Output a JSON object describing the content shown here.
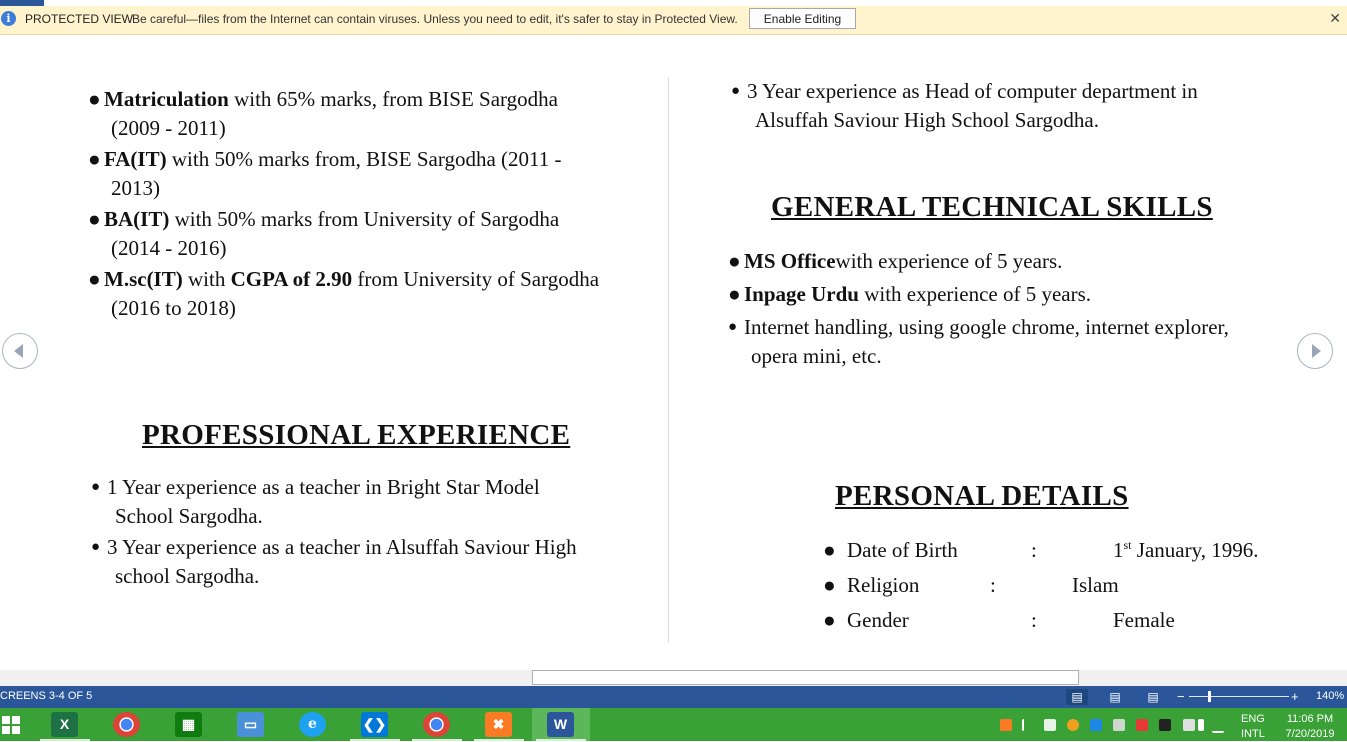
{
  "protected_view": {
    "title": "PROTECTED VIEW",
    "message": "Be careful—files from the Internet can contain viruses. Unless you need to edit, it's safer to stay in Protected View.",
    "enable_button": "Enable Editing",
    "close_glyph": "✕",
    "info_glyph": "i"
  },
  "education": {
    "items": [
      {
        "bold": "Matriculation",
        "rest": " with 65% marks, from BISE Sargodha",
        "line2": "(2009 - 2011)"
      },
      {
        "bold": "FA(IT)",
        "rest": " with 50% marks from, BISE Sargodha  (2011 -",
        "line2": "2013)"
      },
      {
        "bold": "BA(IT)",
        "rest": " with 50% marks from University of  Sargodha",
        "line2": "(2014 - 2016)"
      },
      {
        "bold": "M.sc(IT)",
        "rest_pre": " with ",
        "bold2": "CGPA of 2.90",
        "rest": " from University of Sargodha",
        "line2": "(2016 to 2018)"
      }
    ]
  },
  "professional": {
    "heading": "PROFESSIONAL EXPERIENCE",
    "items": [
      {
        "line1": "1 Year experience as a teacher in Bright Star Model",
        "line2": "School Sargodha."
      },
      {
        "line1": "3 Year experience as a teacher in Alsuffah Saviour High",
        "line2": "school Sargodha."
      }
    ]
  },
  "experience_cont": {
    "line1": "3 Year experience as Head of computer department in",
    "line2": "Alsuffah Saviour High School Sargodha."
  },
  "skills": {
    "heading": "GENERAL TECHNICAL SKILLS",
    "items": [
      {
        "bold": "MS Office",
        "rest": "with experience of 5 years."
      },
      {
        "bold": "Inpage Urdu",
        "rest": " with experience of 5 years."
      },
      {
        "bold": "",
        "rest": "Internet handling, using google chrome, internet explorer,",
        "line2": "opera mini, etc."
      }
    ]
  },
  "personal": {
    "heading": "PERSONAL DETAILS",
    "rows": [
      {
        "label": "Date of Birth",
        "sep": ":",
        "value_pre": "1",
        "value_sup": "st",
        "value": " January, 1996."
      },
      {
        "label": "Religion",
        "sep": ":",
        "value": "Islam"
      },
      {
        "label": "Gender",
        "sep": ":",
        "value": "Female"
      }
    ]
  },
  "bullet": "●",
  "statusbar": {
    "text": "CREENS 3-4 OF 5",
    "zoom": "140%",
    "zoom_minus": "−",
    "zoom_plus": "+"
  },
  "taskbar": {
    "apps": [
      {
        "name": "Excel",
        "letter": "X",
        "color": "#1e7145"
      },
      {
        "name": "Chrome",
        "color": "#db4437"
      },
      {
        "name": "Store",
        "color": "#107c10"
      },
      {
        "name": "This PC",
        "color": "#4a90d9"
      },
      {
        "name": "Internet Explorer",
        "letter": "e",
        "color": "#1ea1f1"
      },
      {
        "name": "Visual Studio Code",
        "color": "#0078d7"
      },
      {
        "name": "Chrome",
        "color": "#db4437"
      },
      {
        "name": "XAMPP",
        "color": "#fb7a24"
      },
      {
        "name": "Word",
        "letter": "W",
        "color": "#2b579a"
      }
    ],
    "lang_1": "ENG",
    "lang_2": "INTL",
    "time": "11:06 PM",
    "date": "7/20/2019"
  },
  "colors": {
    "protected_bar": "#fff4ce",
    "statusbar": "#2b579a",
    "taskbar": "#3aa136"
  }
}
